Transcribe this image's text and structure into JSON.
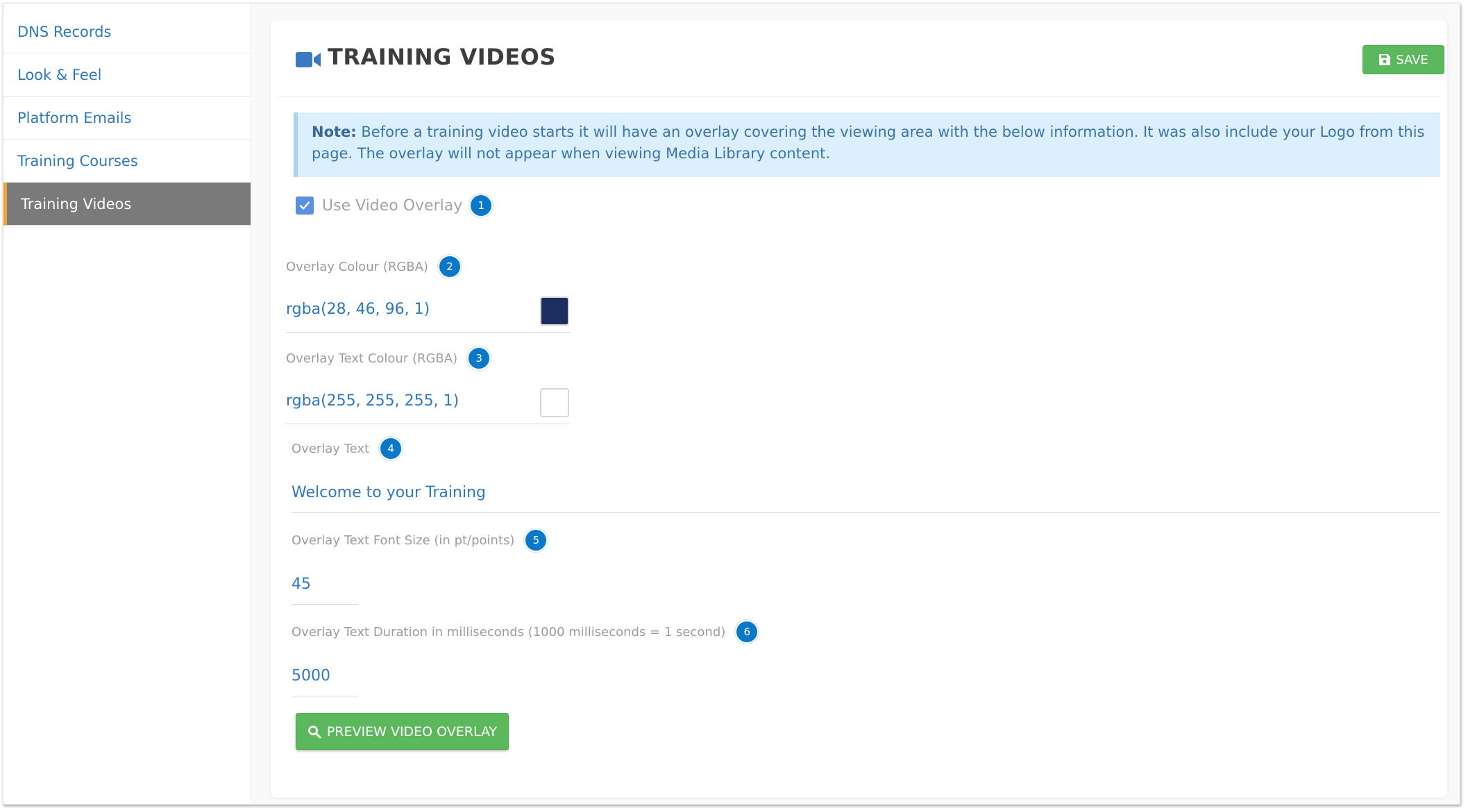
{
  "sidebar": {
    "items": [
      {
        "label": "DNS Records"
      },
      {
        "label": "Look & Feel"
      },
      {
        "label": "Platform Emails"
      },
      {
        "label": "Training Courses"
      },
      {
        "label": "Training Videos"
      }
    ],
    "active_index": 4
  },
  "header": {
    "title": "TRAINING VIDEOS",
    "title_icon": "video-camera-icon",
    "save_label": "SAVE",
    "save_icon": "floppy-disk-icon"
  },
  "note": {
    "bold": "Note:",
    "text": " Before a training video starts it will have an overlay covering the viewing area with the below information. It was also include your Logo from this page. The overlay will not appear when viewing Media Library content."
  },
  "overlay_checkbox": {
    "label": "Use Video Overlay",
    "checked": true,
    "badge": "1"
  },
  "fields": {
    "overlay_colour": {
      "label": "Overlay Colour (RGBA)",
      "value": "rgba(28, 46, 96, 1)",
      "badge": "2",
      "swatch": "#1c2e60"
    },
    "overlay_text_colour": {
      "label": "Overlay Text Colour (RGBA)",
      "value": "rgba(255, 255, 255, 1)",
      "badge": "3",
      "swatch": "#ffffff"
    },
    "overlay_text": {
      "label": "Overlay Text",
      "value": "Welcome to your Training",
      "badge": "4"
    },
    "font_size": {
      "label": "Overlay Text Font Size (in pt/points)",
      "value": "45",
      "badge": "5"
    },
    "duration": {
      "label": "Overlay Text Duration in milliseconds (1000 milliseconds = 1 second)",
      "value": "5000",
      "badge": "6"
    }
  },
  "preview_button": {
    "label": "PREVIEW VIDEO OVERLAY",
    "icon": "search-icon"
  },
  "colors": {
    "accent_blue": "#2e78bf",
    "success_green": "#5cb85c",
    "badge_blue": "#0a78c8",
    "active_sidebar": "#7a7a7a",
    "active_marker": "#f2a23b"
  }
}
